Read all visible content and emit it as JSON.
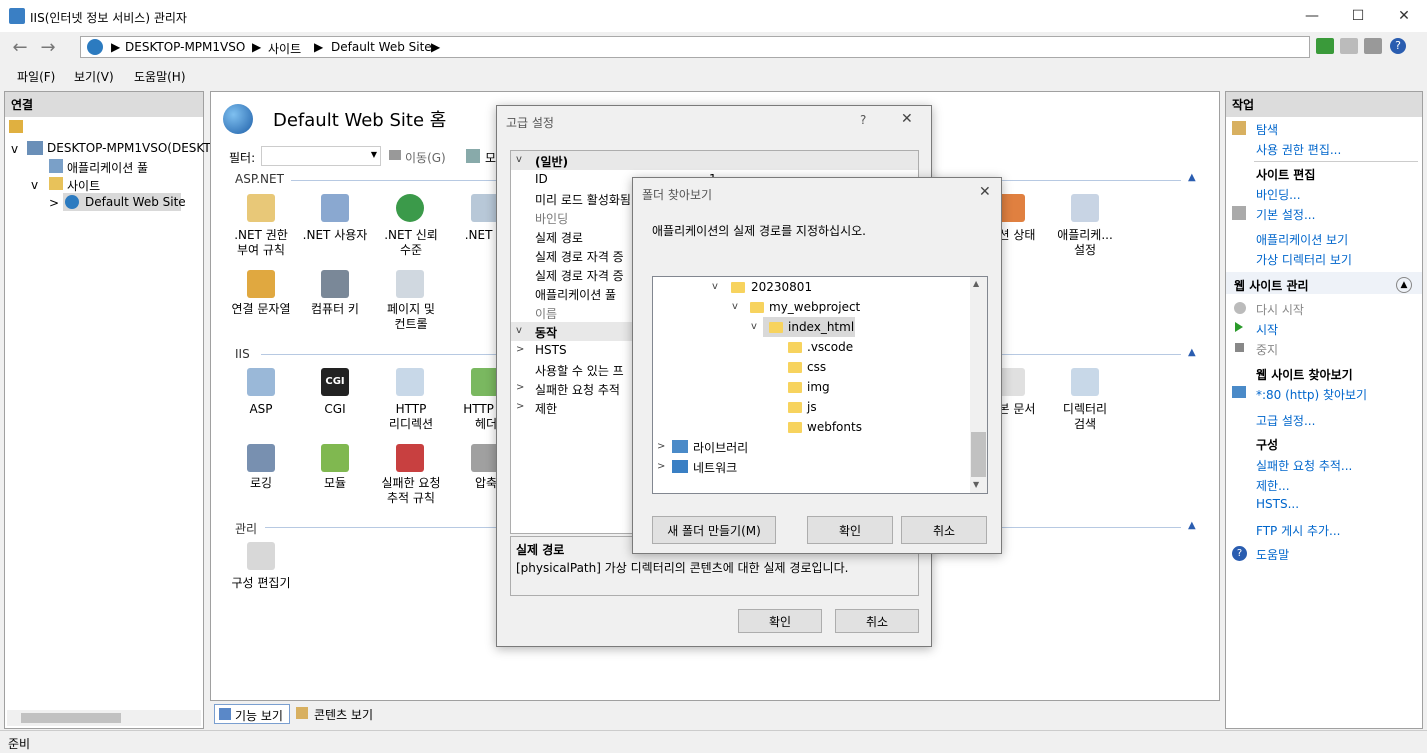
{
  "window": {
    "title": "IIS(인터넷 정보 서비스) 관리자"
  },
  "address": {
    "crumbs": [
      "DESKTOP-MPM1VSO",
      "사이트",
      "Default Web Site"
    ]
  },
  "menu": [
    "파일(F)",
    "보기(V)",
    "도움말(H)"
  ],
  "left": {
    "header": "연결",
    "tree": [
      "DESKTOP-MPM1VSO(DESKT",
      "애플리케이션 풀",
      "사이트",
      "Default Web Site"
    ]
  },
  "center": {
    "title": "Default Web Site 홈",
    "filter_label": "필터:",
    "go_label": "이동(G)",
    "show_label": "모",
    "sections": [
      "ASP.NET",
      "IIS",
      "관리"
    ],
    "aspnet_items": [
      ".NET 권한\n부여 규칙",
      ".NET 사용자",
      ".NET 신뢰\n수준",
      ".NET 역",
      "연결 문자열",
      "컴퓨터 키",
      "페이지 및\n컨트롤"
    ],
    "aspnet_right": [
      "션 상태",
      "애플리케...\n설정"
    ],
    "iis_items": [
      "ASP",
      "CGI",
      "HTTP\n리디렉션",
      "HTTP 응\n헤더",
      "로깅",
      "모듈",
      "실패한 요청\n추적 규칙",
      "압축"
    ],
    "iis_right": [
      "본 문서",
      "디렉터리\n검색"
    ],
    "mgmt_items": [
      "구성 편집기"
    ],
    "tabs": [
      "기능 보기",
      "콘텐츠 보기"
    ]
  },
  "right": {
    "header": "작업",
    "items": [
      "탐색",
      "사용 권한 편집...",
      "사이트 편집",
      "바인딩...",
      "기본 설정...",
      "애플리케이션 보기",
      "가상 디렉터리 보기",
      "웹 사이트 관리",
      "다시 시작",
      "시작",
      "중지",
      "웹 사이트 찾아보기",
      "*:80 (http) 찾아보기",
      "고급 설정...",
      "구성",
      "실패한 요청 추적...",
      "제한...",
      "HSTS...",
      "FTP 게시 추가...",
      "도움말"
    ]
  },
  "status": {
    "text": "준비"
  },
  "adv_dialog": {
    "title": "고급 설정",
    "help": "?",
    "rows": [
      "(일반)",
      "ID",
      "미리 로드 활성화됨",
      "바인딩",
      "실제 경로",
      "실제 경로 자격 증",
      "실제 경로 자격 증",
      "애플리케이션 풀",
      "이름",
      "동작",
      "HSTS",
      "사용할 수 있는 프",
      "실패한 요청 추적",
      "제한"
    ],
    "id_value": "1",
    "desc_title": "실제 경로",
    "desc_text": "[physicalPath] 가상 디렉터리의 콘텐츠에 대한 실제 경로입니다.",
    "ok": "확인",
    "cancel": "취소"
  },
  "folder_dialog": {
    "title": "폴더 찾아보기",
    "prompt": "애플리케이션의 실제 경로를 지정하십시오.",
    "tree": [
      "20230801",
      "my_webproject",
      "index_html",
      ".vscode",
      "css",
      "img",
      "js",
      "webfonts",
      "라이브러리",
      "네트워크"
    ],
    "new_folder": "새 폴더 만들기(M)",
    "ok": "확인",
    "cancel": "취소"
  }
}
